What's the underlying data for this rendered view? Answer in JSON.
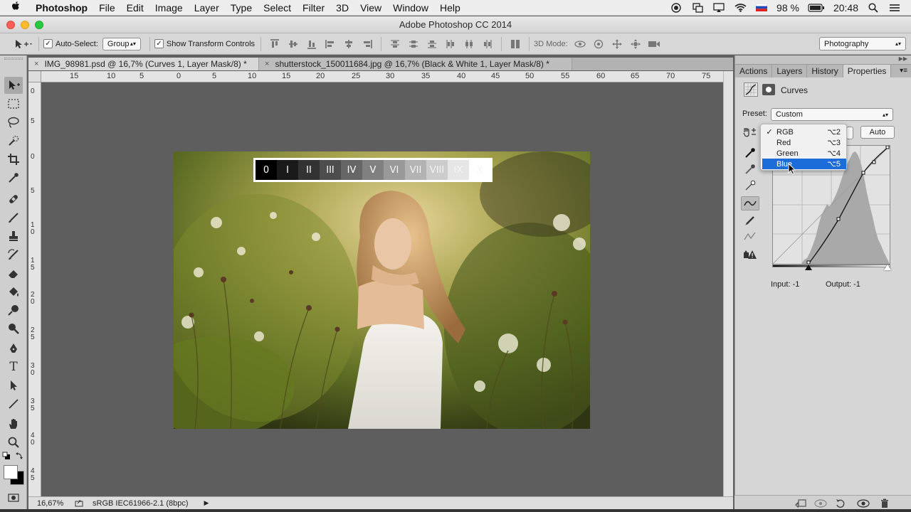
{
  "menubar": {
    "app": "Photoshop",
    "items": [
      "File",
      "Edit",
      "Image",
      "Layer",
      "Type",
      "Select",
      "Filter",
      "3D",
      "View",
      "Window",
      "Help"
    ],
    "battery": "98 %",
    "time": "20:48"
  },
  "window": {
    "title": "Adobe Photoshop CC 2014"
  },
  "options": {
    "auto_select_label": "Auto-Select:",
    "auto_select_value": "Group",
    "show_transform_label": "Show Transform Controls",
    "mode_3d_label": "3D Mode:",
    "workspace": "Photography"
  },
  "tabs": [
    {
      "close": "×",
      "label": "IMG_98981.psd @ 16,7% (Curves 1, Layer Mask/8) *"
    },
    {
      "close": "×",
      "label": "shutterstock_150011684.jpg @ 16,7% (Black & White 1, Layer Mask/8) *"
    }
  ],
  "ruler": {
    "h": [
      "15",
      "10",
      "5",
      "0",
      "5",
      "10",
      "15",
      "20",
      "25",
      "30",
      "35",
      "40",
      "45",
      "50",
      "55",
      "60",
      "65",
      "70",
      "75"
    ],
    "v": [
      "0",
      "5",
      "0",
      "5",
      "10",
      "15",
      "20",
      "25",
      "30",
      "35",
      "40",
      "45"
    ]
  },
  "scale": [
    "0",
    "I",
    "II",
    "III",
    "IV",
    "V",
    "VI",
    "VII",
    "VIII",
    "IX",
    "X"
  ],
  "status": {
    "zoom": "16,67%",
    "profile": "sRGB IEC61966-2.1 (8bpc)"
  },
  "panel": {
    "tabs": [
      "Actions",
      "Layers",
      "History",
      "Properties"
    ],
    "title": "Curves",
    "preset_label": "Preset:",
    "preset_value": "Custom",
    "auto_label": "Auto",
    "input_label": "Input: -1",
    "output_label": "Output: -1",
    "channels": [
      {
        "label": "RGB",
        "shortcut": "⌥2",
        "checked": true
      },
      {
        "label": "Red",
        "shortcut": "⌥3",
        "checked": false
      },
      {
        "label": "Green",
        "shortcut": "⌥4",
        "checked": false
      },
      {
        "label": "Blue",
        "shortcut": "⌥5",
        "checked": false,
        "highlighted": true
      }
    ]
  },
  "colors": {
    "selection": "#1c6cd9",
    "canvas": "#5e5e5e"
  }
}
